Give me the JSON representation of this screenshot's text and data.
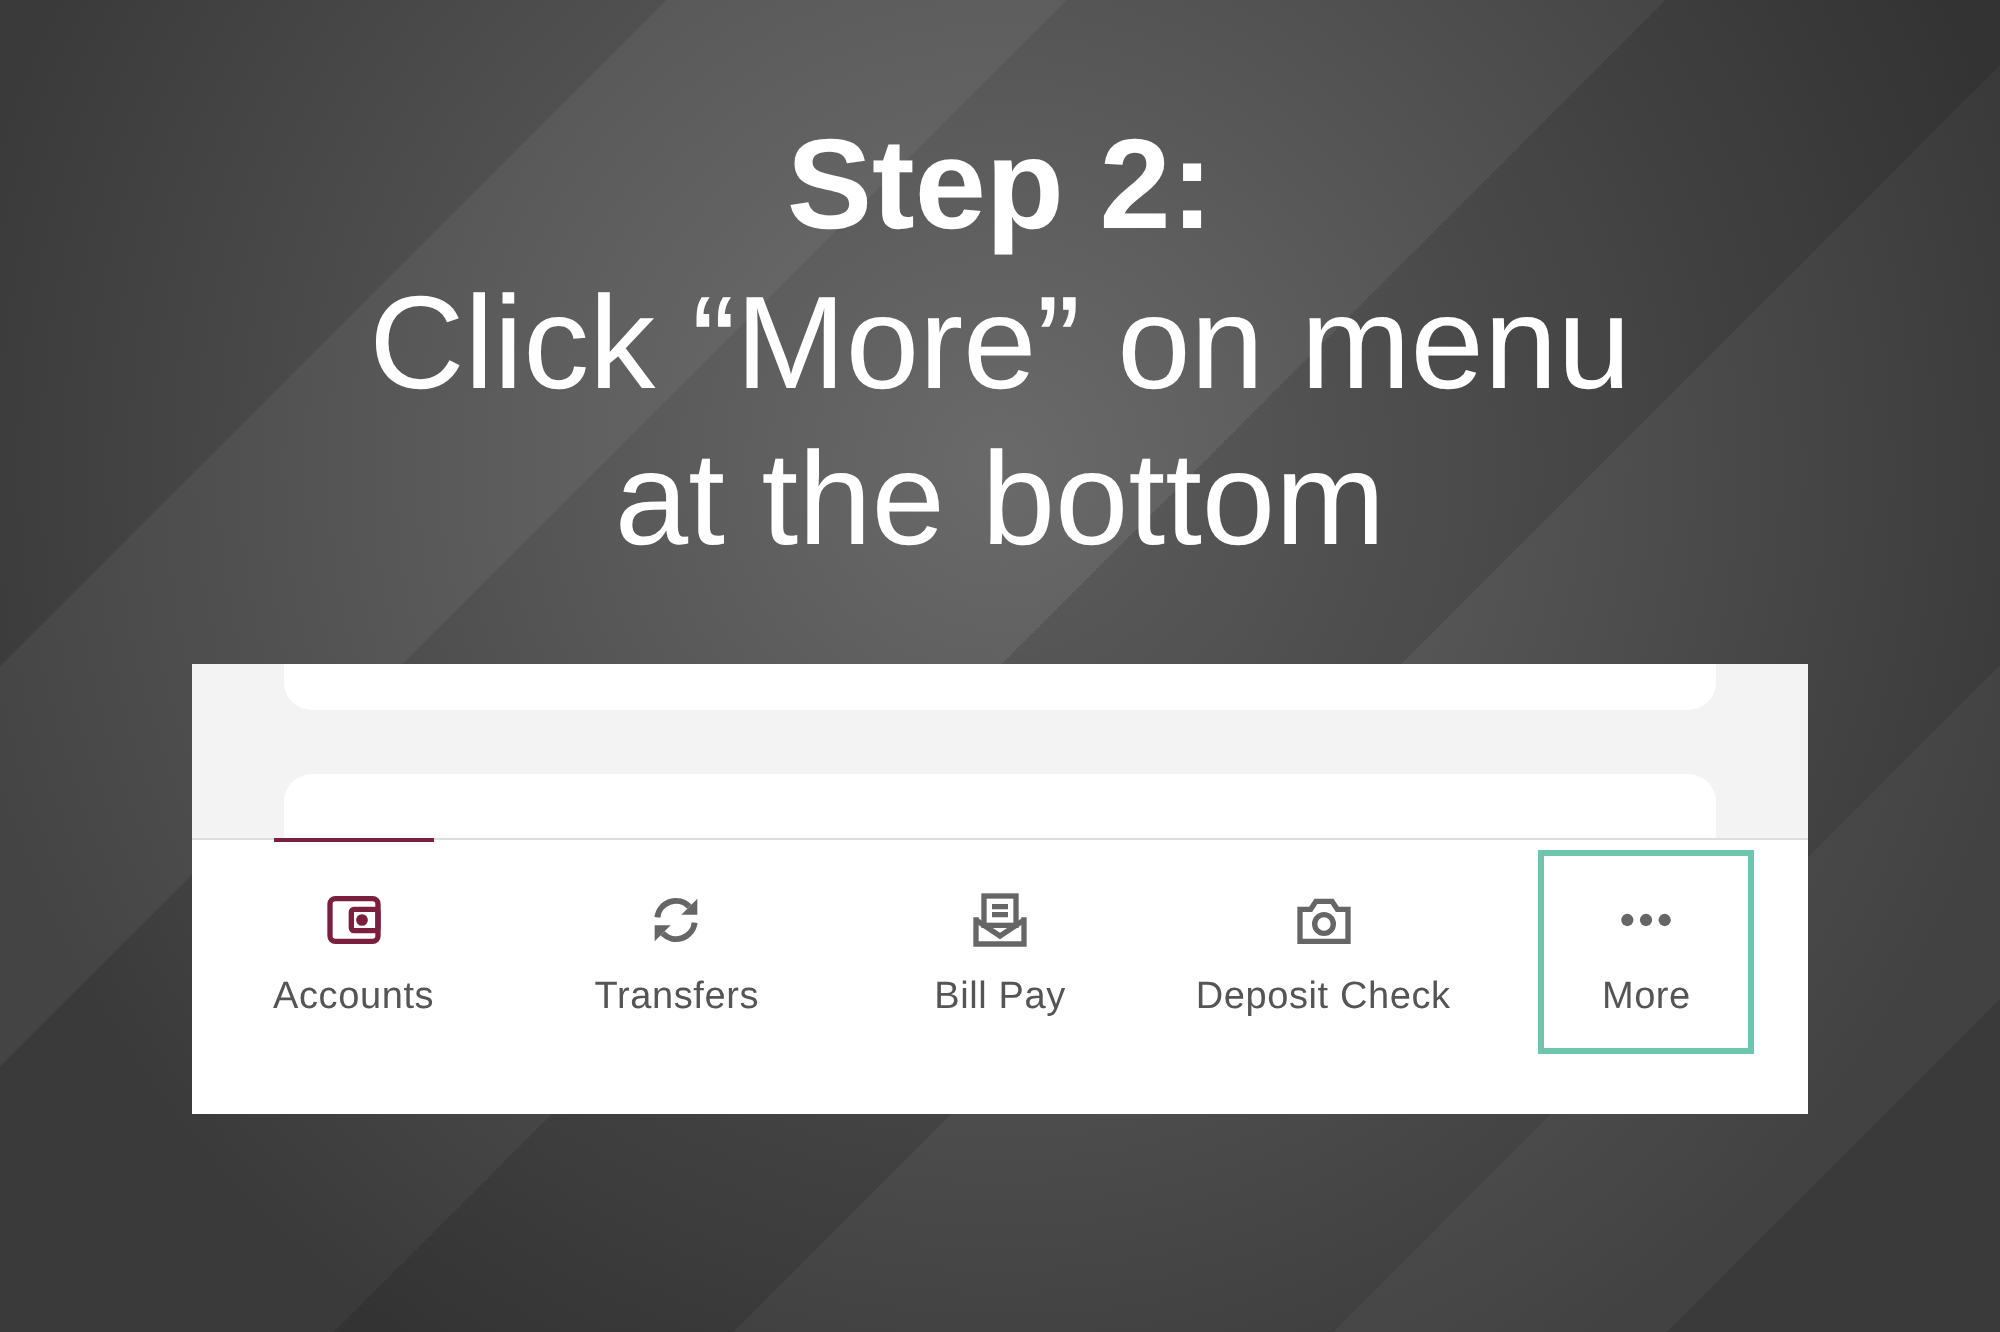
{
  "heading": {
    "title": "Step 2:",
    "subtitle": "Click “More” on menu at the bottom"
  },
  "tab_bar": {
    "tabs": [
      {
        "label": "Accounts",
        "kind": "wallet",
        "selected": true,
        "highlighted": false
      },
      {
        "label": "Transfers",
        "kind": "sync",
        "selected": false,
        "highlighted": false
      },
      {
        "label": "Bill Pay",
        "kind": "bill",
        "selected": false,
        "highlighted": false
      },
      {
        "label": "Deposit Check",
        "kind": "camera",
        "selected": false,
        "highlighted": false
      },
      {
        "label": "More",
        "kind": "more",
        "selected": false,
        "highlighted": true
      }
    ]
  }
}
